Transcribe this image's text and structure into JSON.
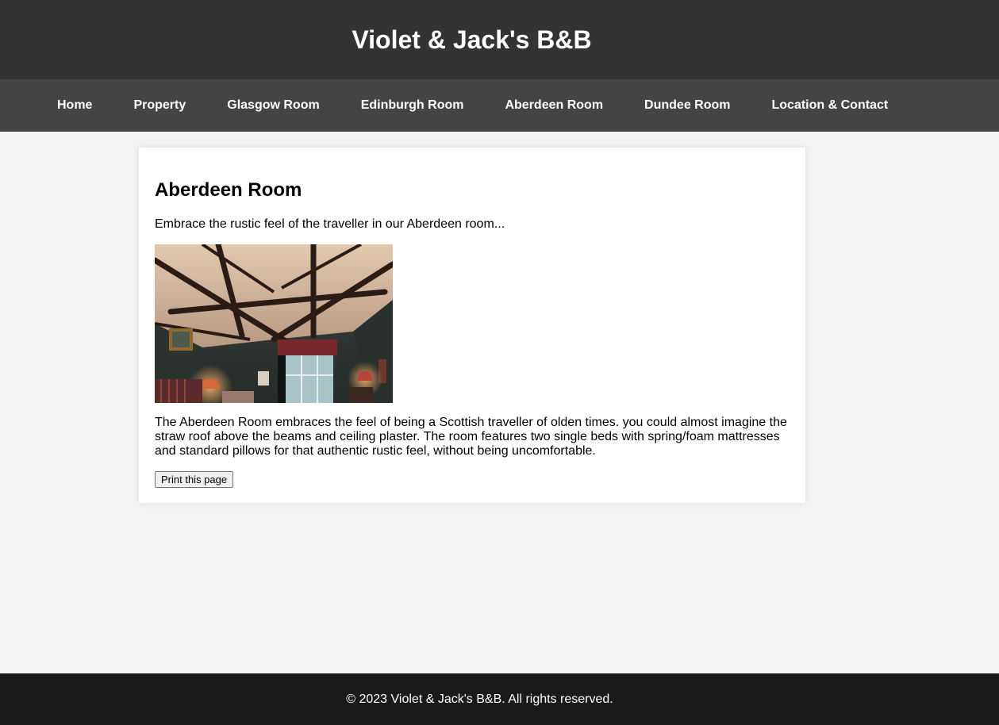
{
  "header": {
    "title": "Violet & Jack's B&B"
  },
  "nav": {
    "items": [
      {
        "label": "Home"
      },
      {
        "label": "Property"
      },
      {
        "label": "Glasgow Room"
      },
      {
        "label": "Edinburgh Room"
      },
      {
        "label": "Aberdeen Room"
      },
      {
        "label": "Dundee Room"
      },
      {
        "label": "Location & Contact"
      }
    ]
  },
  "main": {
    "title": "Aberdeen Room",
    "intro": "Embrace the rustic feel of the traveller in our Aberdeen room...",
    "description": "The Aberdeen Room embraces the feel of being a Scottish traveller of olden times. you could almost imagine the straw roof above the beams and ceiling plaster. The room features two single beds with spring/foam mattresses and standard pillows for that authentic rustic feel, without being uncomfortable.",
    "print_label": "Print this page"
  },
  "footer": {
    "text": "© 2023 Violet & Jack's B&B. All rights reserved."
  },
  "colors": {
    "header_bg": "#333333",
    "nav_bg": "#444444",
    "page_bg": "#f3f3f3",
    "card_bg": "#ffffff",
    "footer_bg": "#1a1a1a"
  }
}
